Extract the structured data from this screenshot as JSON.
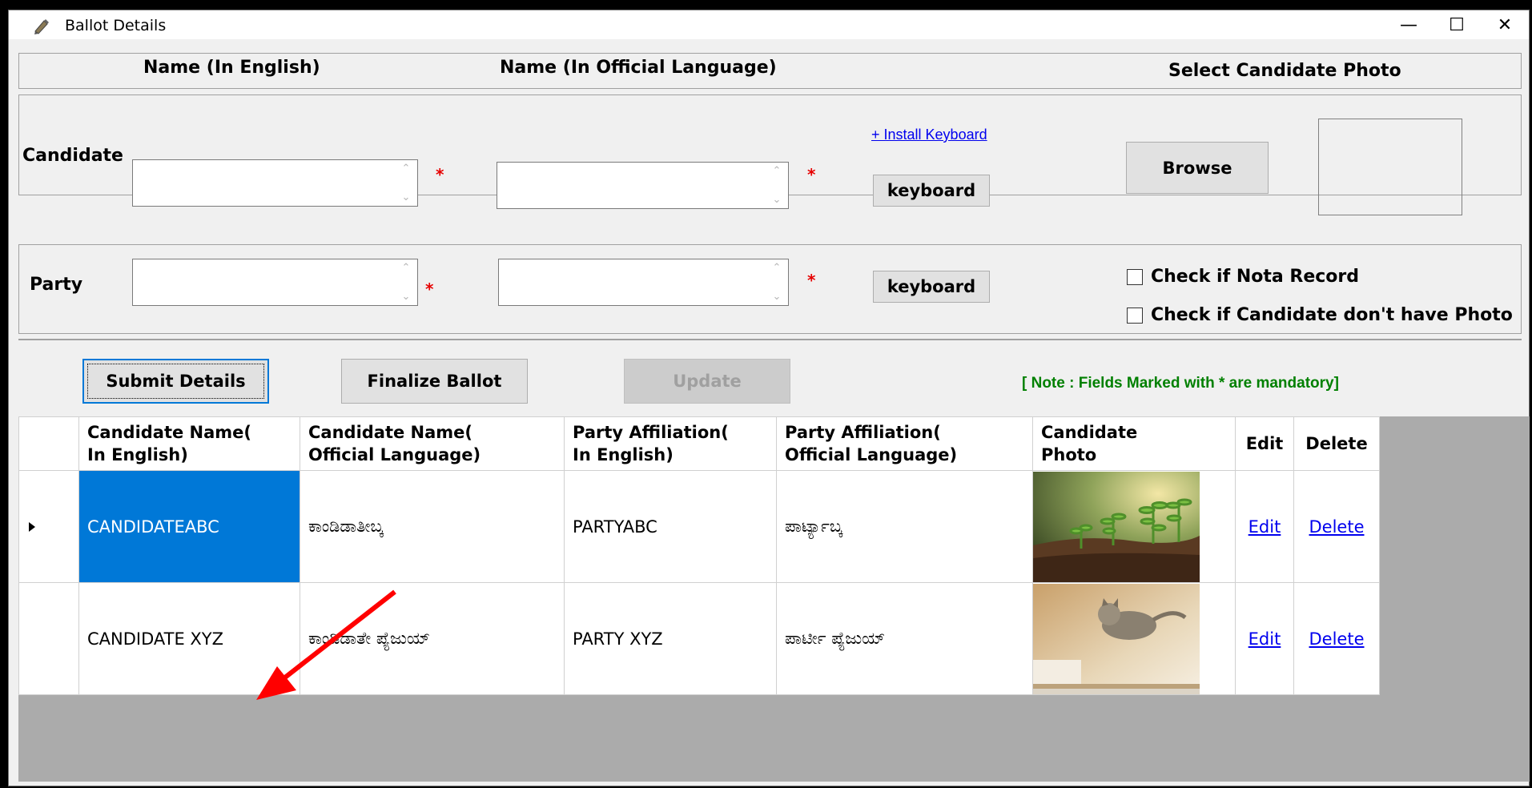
{
  "window": {
    "title": "Ballot Details",
    "minimize": "—",
    "maximize": "☐",
    "close": "✕"
  },
  "headers": {
    "name_english": "Name (In English)",
    "name_official": "Name (In Official Language)",
    "select_photo": "Select Candidate Photo"
  },
  "candidate_row": {
    "label": "Candidate",
    "english_value": "",
    "official_value": "",
    "required_mark": "*",
    "install_keyboard": "+ Install Keyboard",
    "keyboard_label": "keyboard",
    "browse_label": "Browse"
  },
  "party_row": {
    "label": "Party",
    "english_value": "",
    "official_value": "",
    "required_mark": "*",
    "keyboard_label": "keyboard",
    "nota_label": "Check if Nota Record",
    "nophoto_label": "Check if Candidate don't have Photo",
    "nota_checked": false,
    "nophoto_checked": false
  },
  "actions": {
    "submit": "Submit Details",
    "finalize": "Finalize Ballot",
    "update": "Update",
    "note": "[ Note : Fields Marked with * are mandatory]"
  },
  "grid": {
    "columns": [
      "Candidate Name(\nIn English)",
      "Candidate Name(\nOfficial Language)",
      "Party Affiliation(\nIn English)",
      "Party Affiliation(\nOfficial Language)",
      "Candidate\nPhoto",
      "Edit",
      "Delete"
    ],
    "rows": [
      {
        "name_en": "CANDIDATEABC",
        "name_off": "ಕಾಂಡಿಡಾತೀಬ್ಕ",
        "party_en": "PARTYABC",
        "party_off": "ಪಾರ್ಟ್ಯಾಬ್ಕ",
        "photo": "seedlings-photo",
        "edit": "Edit",
        "delete": "Delete",
        "selected": true
      },
      {
        "name_en": "CANDIDATE XYZ",
        "name_off": "ಕಾಂಡಿಡಾತೇ ಪ್ಯೆಜುಯ್",
        "party_en": "PARTY XYZ",
        "party_off": "ಪಾರ್ಟೀ ಪ್ಯೆಜುಯ್",
        "photo": "kitten-photo",
        "edit": "Edit",
        "delete": "Delete",
        "selected": false
      }
    ]
  },
  "colors": {
    "selection": "#0078d7",
    "note": "#008000",
    "required": "#e60000",
    "link": "#0000ee",
    "annotation_arrow": "#ff0000"
  }
}
